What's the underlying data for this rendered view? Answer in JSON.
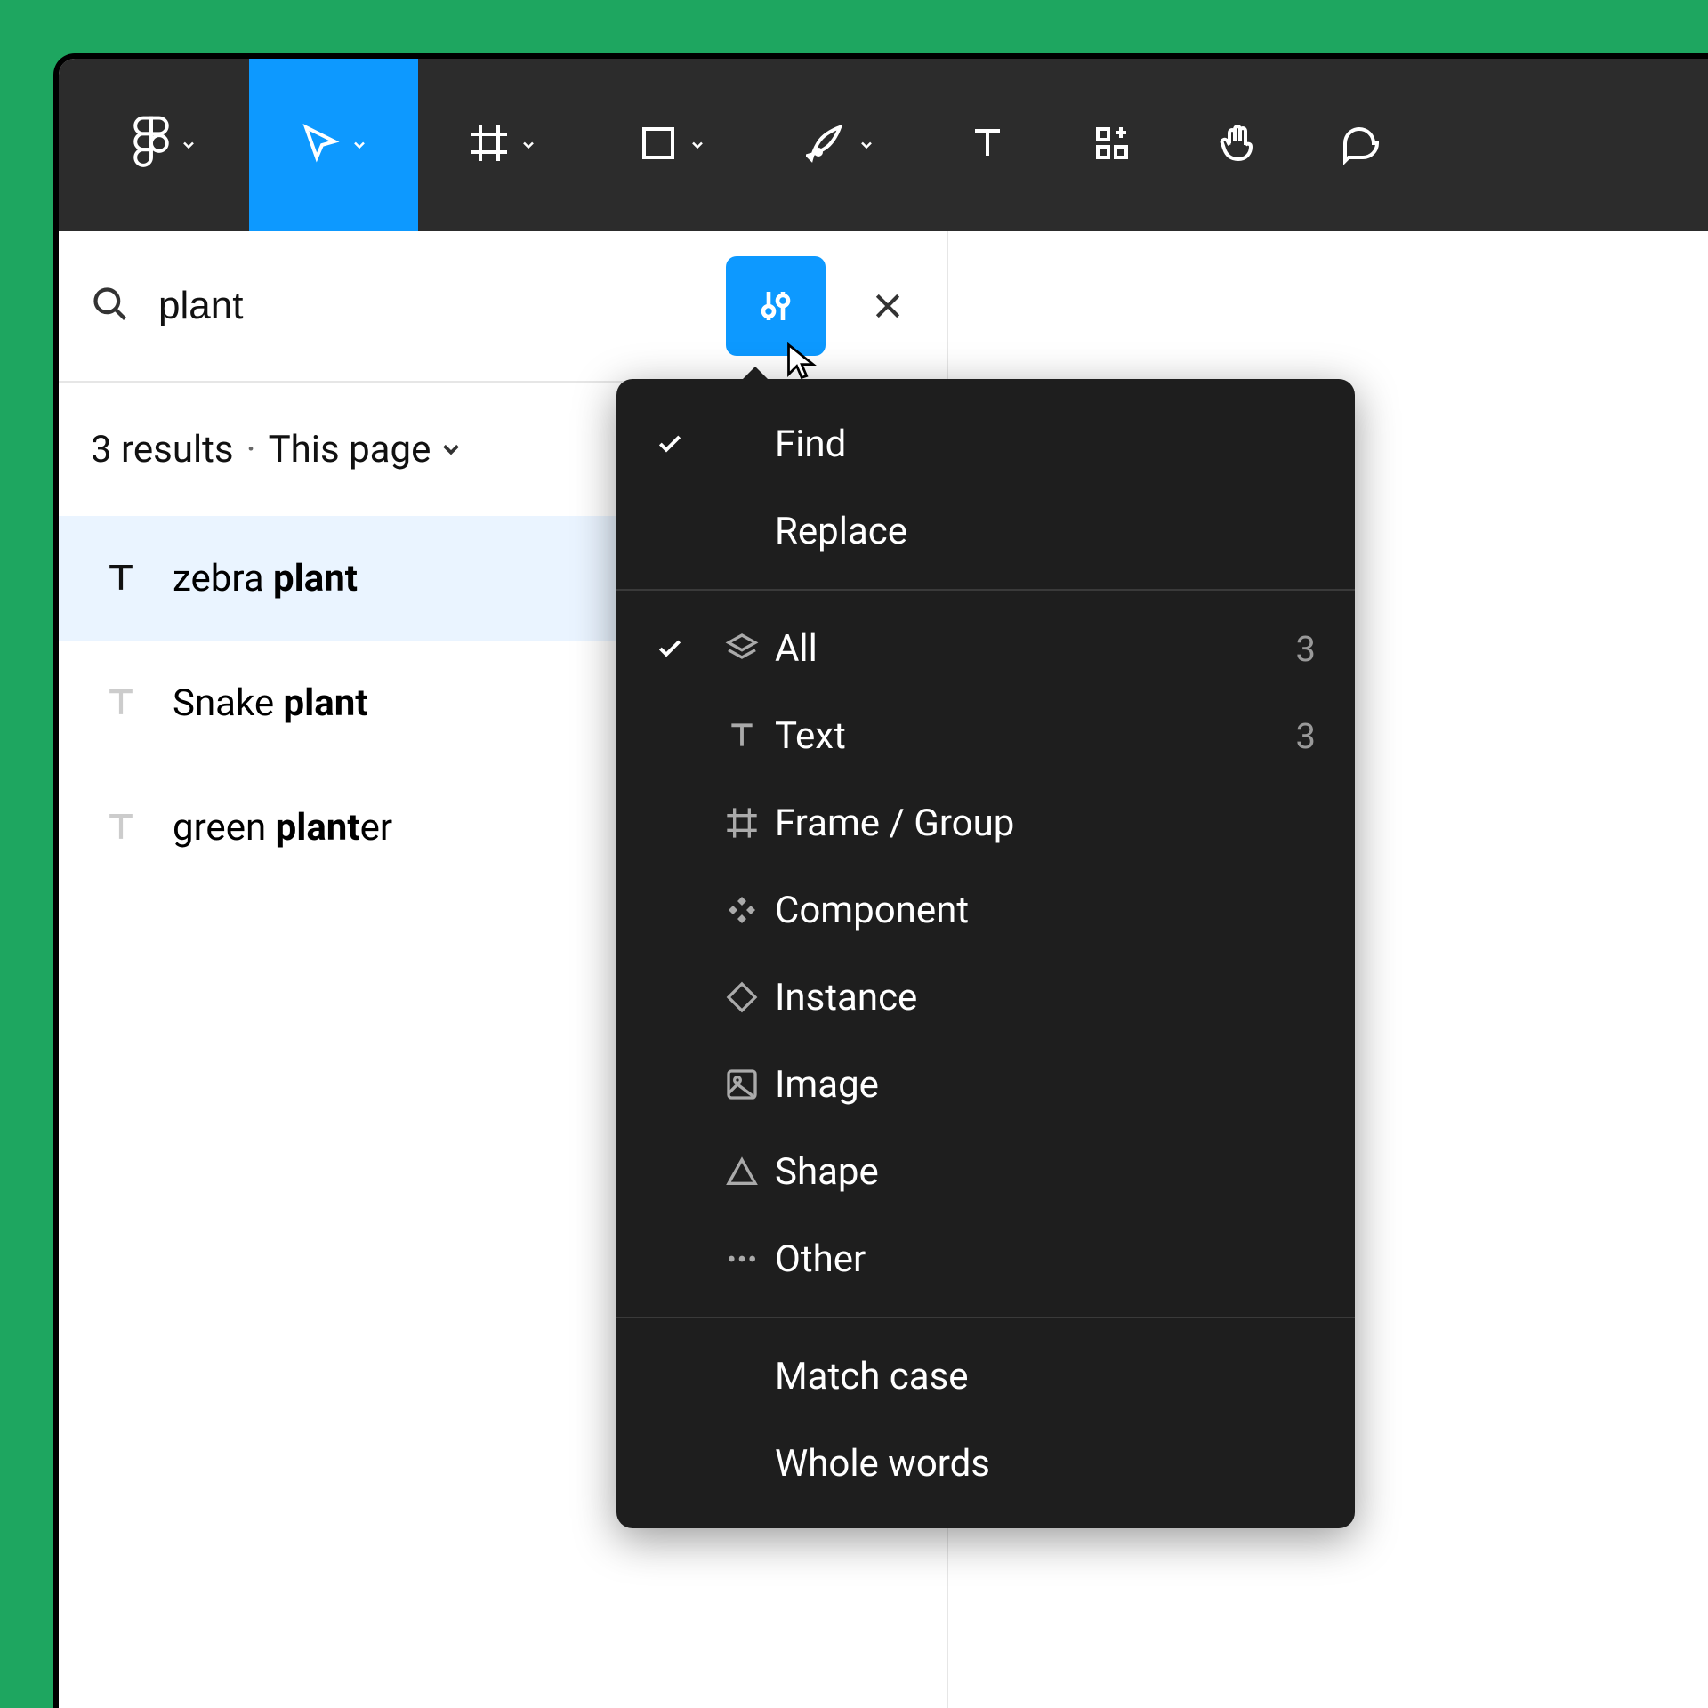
{
  "colors": {
    "accent": "#0d99ff",
    "bg": "#1ea660",
    "toolbar": "#2c2c2c",
    "dropdown": "#1e1e1e"
  },
  "toolbar": {
    "tools": [
      {
        "name": "figma-menu",
        "has_chev": true
      },
      {
        "name": "move-tool",
        "has_chev": true,
        "active": true
      },
      {
        "name": "frame-tool",
        "has_chev": true
      },
      {
        "name": "shape-tool",
        "has_chev": true
      },
      {
        "name": "pen-tool",
        "has_chev": true
      },
      {
        "name": "text-tool",
        "has_chev": false
      },
      {
        "name": "resources-tool",
        "has_chev": false
      },
      {
        "name": "hand-tool",
        "has_chev": false
      },
      {
        "name": "comment-tool",
        "has_chev": false
      }
    ]
  },
  "search": {
    "value": "plant",
    "results_count": "3 results",
    "scope_label": "This page"
  },
  "results": [
    {
      "prefix": "zebra ",
      "match": "plant",
      "suffix": "",
      "selected": true
    },
    {
      "prefix": "Snake ",
      "match": "plant",
      "suffix": "",
      "selected": false
    },
    {
      "prefix": "green ",
      "match": "plant",
      "suffix": "er",
      "selected": false
    }
  ],
  "dropdown": {
    "mode": [
      {
        "label": "Find",
        "checked": true
      },
      {
        "label": "Replace",
        "checked": false
      }
    ],
    "filters": [
      {
        "icon": "layers",
        "label": "All",
        "count": "3",
        "checked": true
      },
      {
        "icon": "text",
        "label": "Text",
        "count": "3",
        "checked": false
      },
      {
        "icon": "frame",
        "label": "Frame / Group",
        "count": "",
        "checked": false
      },
      {
        "icon": "component",
        "label": "Component",
        "count": "",
        "checked": false
      },
      {
        "icon": "instance",
        "label": "Instance",
        "count": "",
        "checked": false
      },
      {
        "icon": "image",
        "label": "Image",
        "count": "",
        "checked": false
      },
      {
        "icon": "shape",
        "label": "Shape",
        "count": "",
        "checked": false
      },
      {
        "icon": "other",
        "label": "Other",
        "count": "",
        "checked": false
      }
    ],
    "options": [
      {
        "label": "Match case"
      },
      {
        "label": "Whole words"
      }
    ]
  }
}
